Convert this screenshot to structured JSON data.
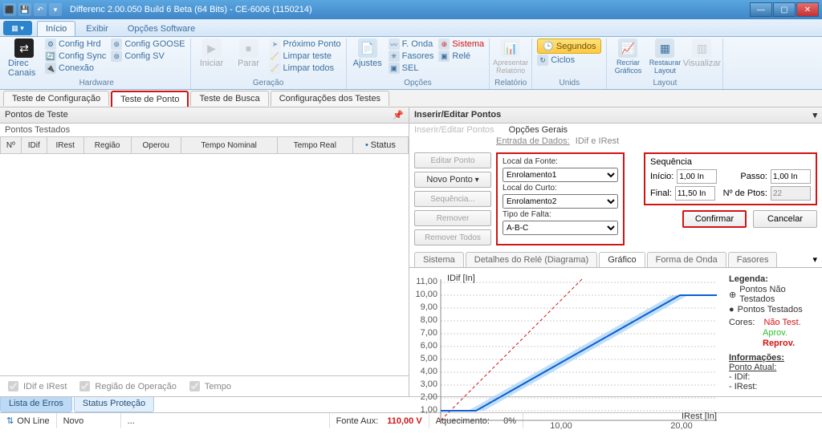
{
  "window": {
    "title": "Differenc 2.00.050 Build 6 Beta (64 Bits)  - CE-6006 (1150214)"
  },
  "ribbon_tabs": {
    "inicio": "Início",
    "exibir": "Exibir",
    "opcoes": "Opções Software"
  },
  "ribbon": {
    "direc": "Direc Canais",
    "hrd": "Config Hrd",
    "goose": "Config GOOSE",
    "sync": "Config Sync",
    "sv": "Config SV",
    "conexao": "Conexão",
    "hardware_lbl": "Hardware",
    "iniciar": "Iniciar",
    "parar": "Parar",
    "prox": "Próximo Ponto",
    "limpar_teste": "Limpar teste",
    "limpar_todos": "Limpar todos",
    "geracao_lbl": "Geração",
    "ajustes": "Ajustes",
    "fonda": "F. Onda",
    "fasores": "Fasores",
    "sel": "SEL",
    "sistema": "Sistema",
    "rele": "Relé",
    "opcoes_lbl": "Opções",
    "apresentar": "Apresentar Relatório",
    "relatorio_lbl": "Relatório",
    "segundos": "Segundos",
    "ciclos": "Ciclos",
    "unids_lbl": "Unids",
    "recriar": "Recriar Gráficos",
    "restaurar": "Restaurar Layout",
    "visualizar": "Visualizar",
    "layout_lbl": "Layout"
  },
  "subtabs": {
    "config": "Teste de Configuração",
    "ponto": "Teste de Ponto",
    "busca": "Teste de Busca",
    "conf_testes": "Configurações dos Testes"
  },
  "left": {
    "hdr": "Pontos de Teste",
    "sub": "Pontos Testados",
    "cols": {
      "n": "Nº",
      "idif": "IDif",
      "irest": "IRest",
      "regiao": "Região",
      "operou": "Operou",
      "tnom": "Tempo Nominal",
      "treal": "Tempo Real",
      "status": "Status"
    },
    "chk1": "IDif e IRest",
    "chk2": "Região de Operação",
    "chk3": "Tempo"
  },
  "ied": {
    "hdr": "Inserir/Editar Pontos",
    "tab1": "Inserir/Editar Pontos",
    "tab2": "Opções Gerais",
    "entrada": "Entrada de Dados:",
    "entrada_v": "IDif e IRest",
    "btn_editar": "Editar Ponto",
    "btn_novo": "Novo Ponto",
    "btn_seq": "Sequência...",
    "btn_rem": "Remover",
    "btn_rem_all": "Remover Todos",
    "local_fonte": "Local da Fonte:",
    "local_fonte_v": "Enrolamento1",
    "local_curto": "Local do Curto:",
    "local_curto_v": "Enrolamento2",
    "tipo_falta": "Tipo de Falta:",
    "tipo_falta_v": "A-B-C",
    "seq_lbl": "Sequência",
    "inicio": "Início:",
    "inicio_v": "1,00 In",
    "passo": "Passo:",
    "passo_v": "1,00 In",
    "final": "Final:",
    "final_v": "11,50 In",
    "nptos": "Nº de Ptos:",
    "nptos_v": "22",
    "confirmar": "Confirmar",
    "cancelar": "Cancelar"
  },
  "gtabs": {
    "sistema": "Sistema",
    "detalhes": "Detalhes do Relé (Diagrama)",
    "grafico": "Gráfico",
    "forma": "Forma de Onda",
    "fasores": "Fasores"
  },
  "legend": {
    "title": "Legenda:",
    "nt": "Pontos Não Testados",
    "t": "Pontos Testados",
    "cores": "Cores:",
    "nao_test": "Não Test.",
    "aprov": "Aprov.",
    "reprov": "Reprov.",
    "info": "Informações:",
    "ponto_atual": "Ponto Atual:",
    "idif": "- IDif:",
    "irest": "- IRest:"
  },
  "chart_data": {
    "type": "line",
    "title": "",
    "xlabel": "IRest [In]",
    "ylabel": "IDif [In]",
    "xlim": [
      0,
      23
    ],
    "ylim": [
      0,
      11
    ],
    "yticks": [
      "1,00",
      "2,00",
      "3,00",
      "4,00",
      "5,00",
      "6,00",
      "7,00",
      "8,00",
      "9,00",
      "10,00",
      "11,00"
    ],
    "xticks": [
      "10,00",
      "20,00"
    ],
    "series": [
      {
        "name": "characteristic",
        "color": "#0a5fd2",
        "points": [
          [
            0,
            0.8
          ],
          [
            3,
            0.8
          ],
          [
            20,
            10
          ],
          [
            23,
            10
          ]
        ]
      },
      {
        "name": "band_upper",
        "color": "#a7d2f5",
        "points": [
          [
            2.3,
            0.8
          ],
          [
            19.3,
            10
          ],
          [
            23,
            10
          ]
        ]
      },
      {
        "name": "band_lower",
        "color": "#a7d2f5",
        "points": [
          [
            3.7,
            0.8
          ],
          [
            20.7,
            10
          ],
          [
            23,
            10
          ]
        ]
      },
      {
        "name": "limit",
        "color": "#d11414",
        "dash": true,
        "points": [
          [
            0,
            0
          ],
          [
            12,
            12
          ]
        ]
      }
    ]
  },
  "bottom_tabs": {
    "erros": "Lista de Erros",
    "status": "Status Proteção"
  },
  "status": {
    "online": "ON Line",
    "novo": "Novo",
    "dots": "...",
    "fonte": "Fonte Aux:",
    "fonte_v": "110,00 V",
    "aquec": "Aquecimento:",
    "aquec_v": "0%"
  }
}
